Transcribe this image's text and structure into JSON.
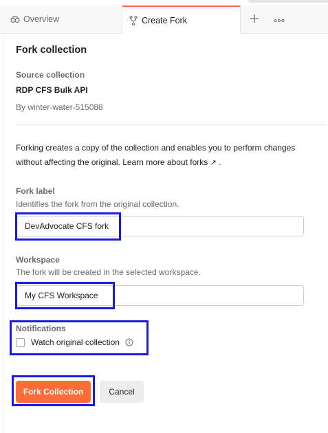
{
  "tabs": [
    {
      "label": "Overview",
      "icon": "overview-icon",
      "active": false
    },
    {
      "label": "Create Fork",
      "icon": "fork-icon",
      "active": true
    }
  ],
  "tab_actions": {
    "new_tab_icon": "plus-icon",
    "more_icon": "more-icon"
  },
  "form": {
    "title": "Fork collection",
    "source_label": "Source collection",
    "source_name": "RDP CFS Bulk API",
    "source_owner": "By winter-water-515088",
    "description_main": "Forking creates a copy of the collection and enables you to perform changes without affecting the original. Learn more about forks",
    "description_link_icon": "↗",
    "description_end": " .",
    "fork_label": {
      "label": "Fork label",
      "help": "Identifies the fork from the original collection.",
      "value": "DevAdvocate CFS fork"
    },
    "workspace": {
      "label": "Workspace",
      "help": "The fork will be created in the selected workspace.",
      "value": "My CFS Workspace"
    },
    "notifications": {
      "label": "Notifications",
      "checkbox_label": "Watch original collection",
      "checked": false
    },
    "buttons": {
      "primary": "Fork Collection",
      "secondary": "Cancel"
    }
  },
  "colors": {
    "accent": "#ff6c37",
    "highlight": "#1a1ae6"
  }
}
